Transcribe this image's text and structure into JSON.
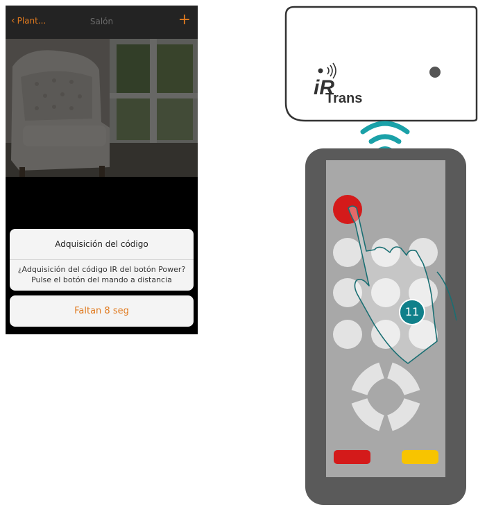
{
  "navbar": {
    "back_label": "Plant...",
    "title": "Salón",
    "add_label": "+"
  },
  "dialog": {
    "title": "Adquisición del código",
    "message_line1": "¿Adquisición del código IR del botón Power?",
    "message_line2": "Pulse el botón del mando a distancia",
    "countdown_label": "Faltan 8 seg"
  },
  "device": {
    "logo_letters": "iR",
    "logo_word": "Trans"
  },
  "step": {
    "number": "11"
  },
  "colors": {
    "accent_orange": "#e07a1f",
    "step_teal": "#10808a",
    "signal_teal": "#1aa1a8",
    "remote_body": "#5a5a5a",
    "remote_panel": "#a8a8a8",
    "power_red": "#d41a1a",
    "yellow_key": "#f7c400"
  },
  "icons": {
    "back": "chevron-left-icon",
    "add": "plus-icon",
    "signal": "ir-signal-icon",
    "hand": "pointing-hand-icon"
  }
}
